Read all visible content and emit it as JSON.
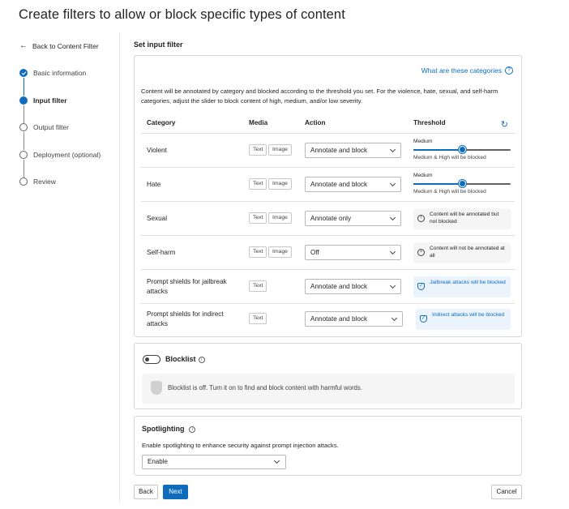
{
  "page_title": "Create filters to allow or block specific types of content",
  "nav": {
    "back_label": "Back to Content Filter",
    "steps": [
      {
        "label": "Basic information",
        "state": "done"
      },
      {
        "label": "Input filter",
        "state": "current"
      },
      {
        "label": "Output filter",
        "state": "todo"
      },
      {
        "label": "Deployment (optional)",
        "state": "todo"
      },
      {
        "label": "Review",
        "state": "todo"
      }
    ]
  },
  "section_title": "Set input filter",
  "categories_link": "What are these categories",
  "description": "Content will be annotated by category and blocked according to the threshold you set. For the violence, hate, sexual, and self-harm categories, adjust the slider to block content of high, medium, and/or low severity.",
  "table": {
    "headers": {
      "category": "Category",
      "media": "Media",
      "action": "Action",
      "threshold": "Threshold"
    },
    "media_text": "Text",
    "media_image": "Image",
    "rows": [
      {
        "category": "Violent",
        "action": "Annotate and block",
        "slider_label": "Medium",
        "slider_level": 0.5,
        "slider_note": "Medium & High will be blocked"
      },
      {
        "category": "Hate",
        "action": "Annotate and block",
        "slider_label": "Medium",
        "slider_level": 0.5,
        "slider_note": "Medium & High will be blocked"
      },
      {
        "category": "Sexual",
        "action": "Annotate only",
        "status": "Content will be annotated but not blocked"
      },
      {
        "category": "Self-harm",
        "action": "Off",
        "status": "Content will not be annotated at all"
      },
      {
        "category": "Prompt shields for jailbreak attacks",
        "action": "Annotate and block",
        "status": "Jailbreak attacks will be blocked"
      },
      {
        "category": "Prompt shields for indirect attacks",
        "action": "Annotate and block",
        "status": "Indirect attacks will be blocked"
      }
    ]
  },
  "blocklist": {
    "title": "Blocklist",
    "enabled": false,
    "message": "Blocklist is off. Turn it on to find and block content with harmful words."
  },
  "spotlighting": {
    "title": "Spotlighting",
    "description": "Enable spotlighting to enhance security against prompt injection attacks.",
    "value": "Enable"
  },
  "buttons": {
    "back": "Back",
    "next": "Next",
    "cancel": "Cancel"
  },
  "colors": {
    "accent": "#0f6cbd"
  }
}
